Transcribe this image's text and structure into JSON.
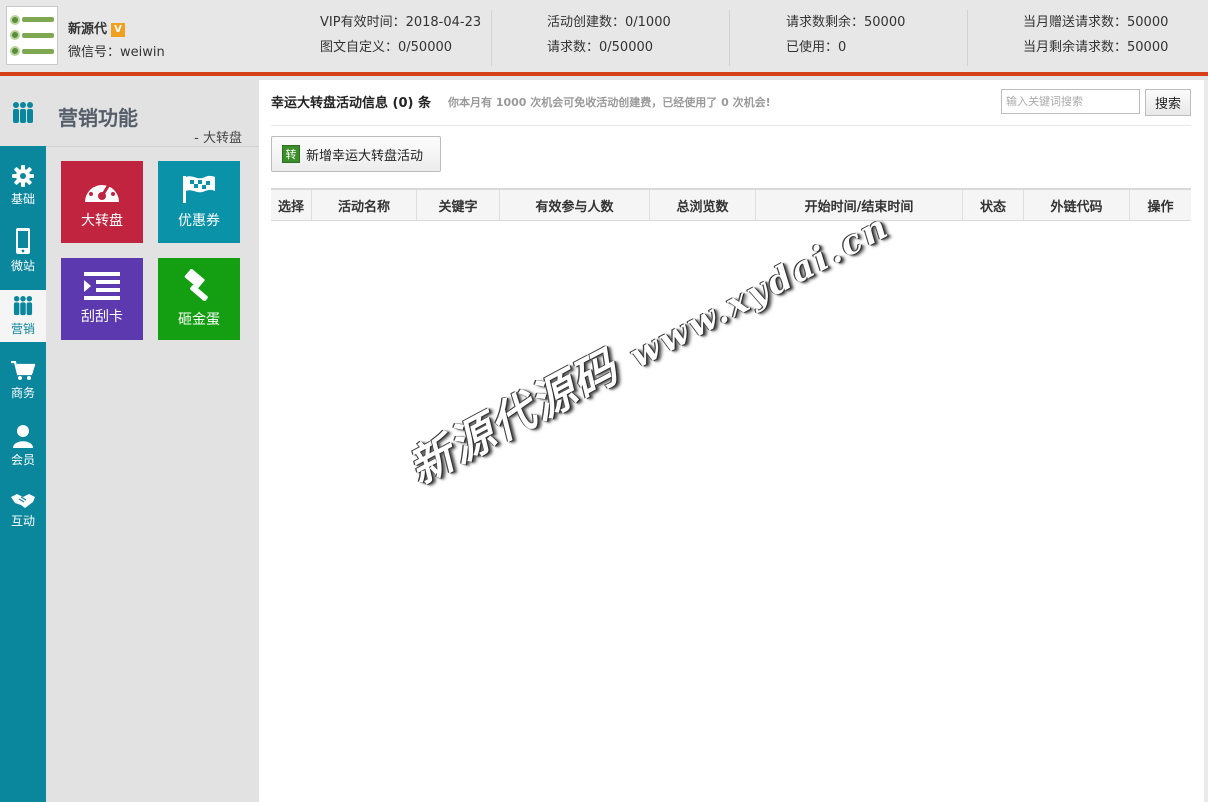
{
  "account": {
    "name": "新源代",
    "vip_badge": "V",
    "wechat": "微信号：weiwin"
  },
  "stats": {
    "vip_expiry": "VIP有效时间：2018-04-23",
    "custom_graphic": "图文自定义：0/50000",
    "activities_created": "活动创建数：0/1000",
    "requests": "请求数：0/50000",
    "requests_left": "请求数剩余：50000",
    "used": "已使用：0",
    "monthly_gift_requests": "当月赠送请求数：50000",
    "monthly_left_requests": "当月剩余请求数：50000"
  },
  "nav": {
    "items": [
      {
        "label": "基础",
        "icon": "gear-icon"
      },
      {
        "label": "微站",
        "icon": "phone-icon"
      },
      {
        "label": "营销",
        "icon": "people-icon"
      },
      {
        "label": "商务",
        "icon": "cart-icon"
      },
      {
        "label": "会员",
        "icon": "user-icon"
      },
      {
        "label": "互动",
        "icon": "handshake-icon"
      }
    ],
    "active": "营销"
  },
  "sidebar": {
    "title": "营销功能",
    "crumb": "- 大转盘",
    "tiles": [
      {
        "label": "大转盘",
        "icon": "dashboard-icon",
        "color": "#c0243f"
      },
      {
        "label": "优惠券",
        "icon": "flag-icon",
        "color": "#0a93a8"
      },
      {
        "label": "刮刮卡",
        "icon": "list-icon",
        "color": "#5d39b0"
      },
      {
        "label": "砸金蛋",
        "icon": "hammer-icon",
        "color": "#139f11"
      }
    ]
  },
  "main": {
    "info_title": "幸运大转盘活动信息 (0) 条",
    "info_note": "你本月有 1000 次机会可免收活动创建费，已经使用了 0 次机会!",
    "search_placeholder": "输入关键词搜索",
    "search_button": "搜索",
    "add_button_badge": "转",
    "add_button": "新增幸运大转盘活动",
    "columns": [
      "选择",
      "活动名称",
      "关键字",
      "有效参与人数",
      "总浏览数",
      "开始时间/结束时间",
      "状态",
      "外链代码",
      "操作"
    ],
    "rows": []
  },
  "watermark": {
    "cn": "新源代源码",
    "url": "www.xydai.cn"
  },
  "colors": {
    "header_accent": "#d4401a",
    "nav_bg": "#0a869d"
  }
}
